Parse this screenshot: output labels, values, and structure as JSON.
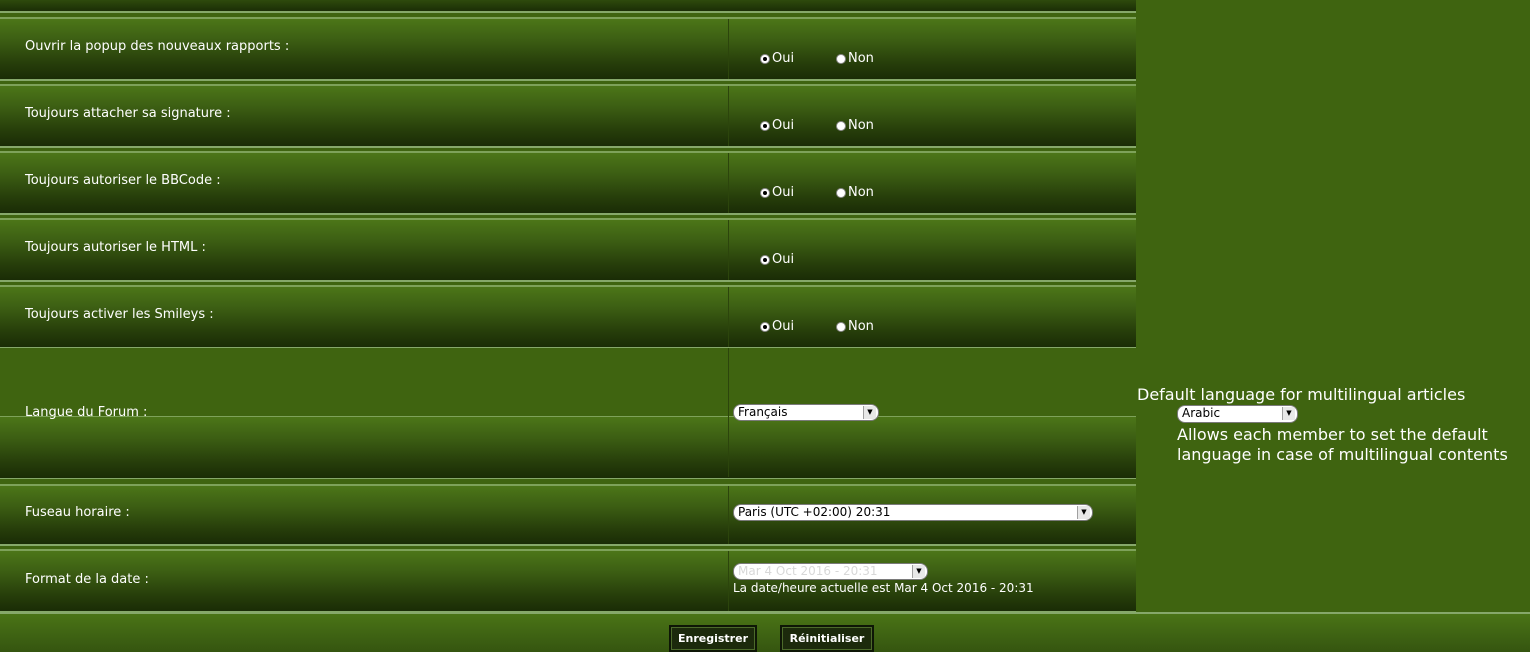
{
  "settings": {
    "popup_reports": {
      "label": "Ouvrir la popup des nouveaux rapports :",
      "yes": "Oui",
      "no": "Non",
      "selected": "Oui"
    },
    "signature": {
      "label": "Toujours attacher sa signature :",
      "yes": "Oui",
      "no": "Non",
      "selected": "Oui"
    },
    "bbcode": {
      "label": "Toujours autoriser le BBCode :",
      "yes": "Oui",
      "no": "Non",
      "selected": "Oui"
    },
    "html": {
      "label": "Toujours autoriser le HTML :",
      "yes": "Oui",
      "selected": "Oui"
    },
    "smileys": {
      "label": "Toujours activer les Smileys :",
      "yes": "Oui",
      "no": "Non",
      "selected": "Oui"
    },
    "language": {
      "label": "Langue du Forum :",
      "value": "Français"
    },
    "timezone": {
      "label": "Fuseau horaire :",
      "value": "Paris (UTC +02:00) 20:31"
    },
    "date_format": {
      "label": "Format de la date :",
      "value": "Mar 4 Oct 2016 - 20:31",
      "note": "La date/heure actuelle est Mar 4 Oct 2016 - 20:31"
    }
  },
  "multilingual": {
    "title": "Default language for multilingual articles",
    "value": "Arabic",
    "description": "Allows each member to set the default language in case of multilingual contents"
  },
  "buttons": {
    "save": "Enregistrer",
    "reset": "Réinitialiser"
  },
  "colors": {
    "background": "#3f6410",
    "row_dark": "#1a2c06",
    "row_border": "#86a86a",
    "text": "#ffffff"
  }
}
